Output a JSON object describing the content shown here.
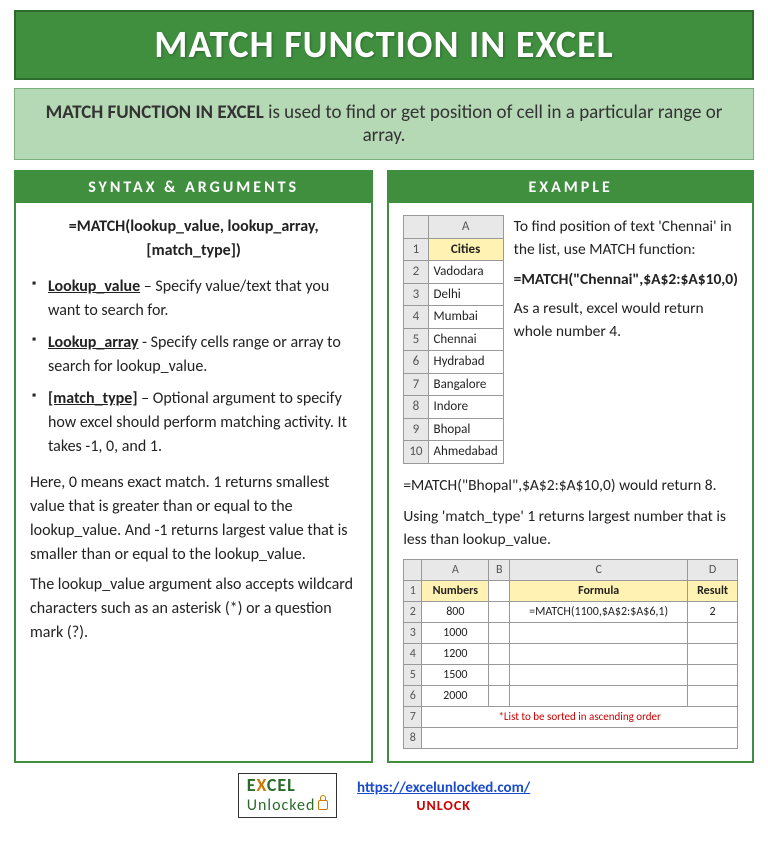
{
  "title": "MATCH FUNCTION IN EXCEL",
  "description": {
    "bold": "MATCH FUNCTION IN EXCEL",
    "rest": " is used to find or get position of cell in a particular range or array."
  },
  "left": {
    "heading": "SYNTAX & ARGUMENTS",
    "formula": "=MATCH(lookup_value, lookup_array, [match_type])",
    "args": [
      {
        "name": "Lookup_value",
        "text": " – Specify value/text that you want to search for."
      },
      {
        "name": "Lookup_array",
        "text": " - Specify cells range or array to search for lookup_value."
      },
      {
        "name": "[match_type]",
        "text": " – Optional argument to specify how excel should perform matching activity. It takes -1, 0, and 1."
      }
    ],
    "para1": "Here, 0 means exact match. 1 returns smallest value that is greater than or equal to the lookup_value. And -1 returns largest value that is smaller than or equal to the lookup_value.",
    "para2": "The lookup_value argument also accepts wildcard characters such as an asterisk (*) or a question mark (?)."
  },
  "right": {
    "heading": "EXAMPLE",
    "cities_col": "A",
    "cities_header": "Cities",
    "cities": [
      "Vadodara",
      "Delhi",
      "Mumbai",
      "Chennai",
      "Hydrabad",
      "Bangalore",
      "Indore",
      "Bhopal",
      "Ahmedabad"
    ],
    "intro1": "To find position of text 'Chennai' in the list, use MATCH function:",
    "formula1": "=MATCH(\"Chennai\",$A$2:$A$10,0)",
    "result1": "As a result, excel would return whole number 4.",
    "para2": "=MATCH(\"Bhopal\",$A$2:$A$10,0) would return 8.",
    "para3": "Using 'match_type' 1 returns largest number that is less than lookup_value.",
    "table2": {
      "cols": [
        "A",
        "B",
        "C",
        "D"
      ],
      "headers": [
        "Numbers",
        "",
        "Formula",
        "Result"
      ],
      "row2": [
        "800",
        "",
        "=MATCH(1100,$A$2:$A$6,1)",
        "2"
      ],
      "numbers": [
        "1000",
        "1200",
        "1500",
        "2000"
      ],
      "note": "*List to be sorted in ascending order"
    }
  },
  "footer": {
    "logo_l1a": "E",
    "logo_l1b": "X",
    "logo_l1c": "CEL",
    "logo_l2": "Unlocked",
    "url": "https://excelunlocked.com/",
    "unlock": "UNLOCK"
  }
}
